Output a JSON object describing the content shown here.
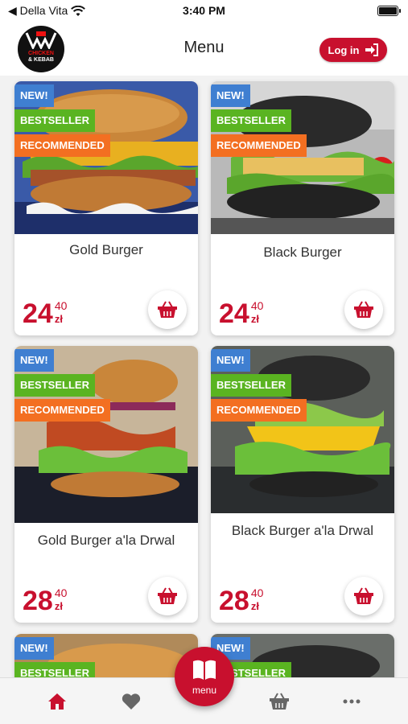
{
  "status_bar": {
    "carrier": "◀ Della Vita",
    "time": "3:40 PM"
  },
  "header": {
    "title": "Menu",
    "login_label": "Log in"
  },
  "logo": {
    "line1": "CHICKEN",
    "line2": "& KEBAB"
  },
  "badges": {
    "new": "NEW!",
    "bestseller": "BESTSELLER",
    "recommended": "RECOMMENDED"
  },
  "products": [
    {
      "name": "Gold Burger",
      "price_main": "24",
      "price_cents": "40",
      "currency": "zł",
      "bun": "#c9863a"
    },
    {
      "name": "Black Burger",
      "price_main": "24",
      "price_cents": "40",
      "currency": "zł",
      "bun": "#2a2a2a"
    },
    {
      "name": "Gold Burger a'la Drwal",
      "price_main": "28",
      "price_cents": "40",
      "currency": "zł",
      "bun": "#c9863a"
    },
    {
      "name": "Black Burger a'la Drwal",
      "price_main": "28",
      "price_cents": "40",
      "currency": "zł",
      "bun": "#2a2a2a"
    }
  ],
  "tabbar": {
    "menu_label": "menu"
  },
  "colors": {
    "brand_red": "#c8102e",
    "badge_new": "#3f7fd1",
    "badge_bestseller": "#5ab421",
    "badge_recommended": "#f36f21"
  }
}
